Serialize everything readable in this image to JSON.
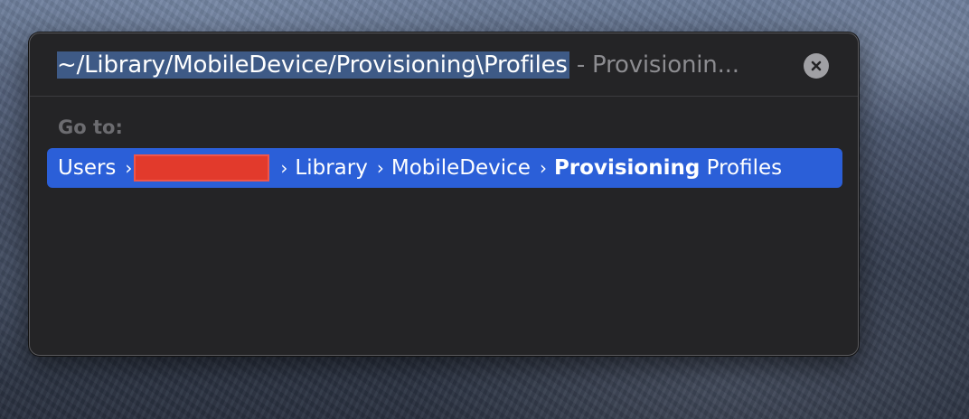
{
  "goto_panel": {
    "path_input": {
      "value": "~/Library/MobileDevice/Provisioning\\Profiles",
      "completion_hint": " - Provisionin..."
    },
    "clear_icon": "xmark-circle-icon",
    "goto_label": "Go to:",
    "result": {
      "crumbs": [
        "Users",
        "Library",
        "MobileDevice"
      ],
      "separator": "›",
      "last_bold": "Provisioning",
      "last_rest": " Profiles",
      "redacted_segment": true
    }
  },
  "colors": {
    "panel_bg": "#242426",
    "selection_bg": "#3e5a86",
    "result_highlight": "#2b5fd8",
    "hint_text": "#8c8c90",
    "label_text": "#6c6c70",
    "redaction": "#e23a2c"
  }
}
